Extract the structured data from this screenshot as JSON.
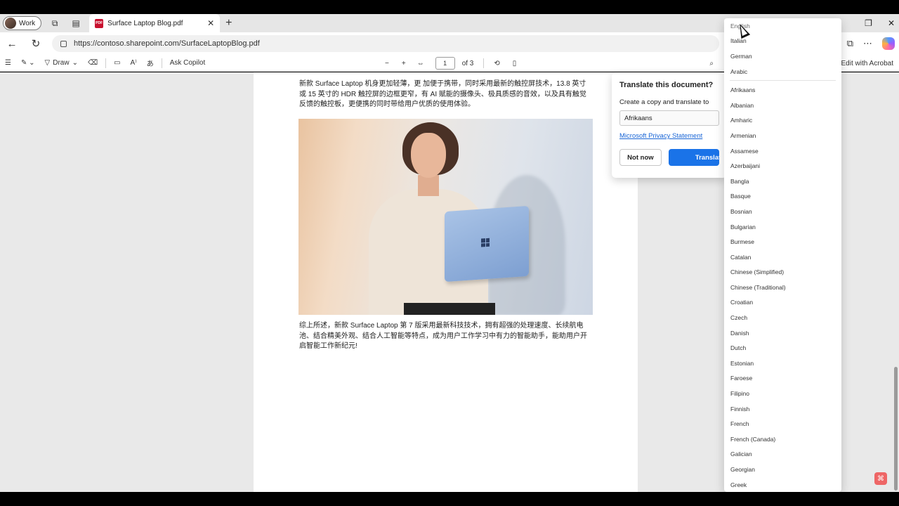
{
  "browser": {
    "profile_label": "Work",
    "tab_title": "Surface Laptop Blog.pdf",
    "tab_icon_label": "PDF",
    "url": "https://contoso.sharepoint.com/SurfaceLaptopBlog.pdf"
  },
  "pdf_toolbar": {
    "draw_label": "Draw",
    "ask_copilot_label": "Ask Copilot",
    "page_current": "1",
    "page_total": "of 3",
    "edit_acrobat_label": "Edit with Acrobat"
  },
  "document": {
    "paragraph_1": "新款 Surface Laptop 机身更加轻薄，更 加便于携带，同时采用最新的触控屏技术，13.8 英寸或 15 英寸的 HDR 触控屏的边框更窄，有 AI 赋能的摄像头、极具质感的音效，以及具有触觉反馈的触控板，更便携的同时带给用户优质的使用体验。",
    "paragraph_2": "综上所述，新款 Surface Laptop 第 7 版采用最新科技技术，拥有超强的处理速度、长续航电池、结合精美外观、结合人工智能等特点，成为用户工作学习中有力的智能助手，能助用户开启智能工作新纪元!"
  },
  "translate_popup": {
    "title": "Translate this document?",
    "label": "Create a copy and translate to",
    "selected_language": "Afrikaans",
    "privacy_link": "Microsoft Privacy Statement",
    "not_now": "Not now",
    "translate": "Translate"
  },
  "language_list": {
    "top": [
      "English",
      "Italian",
      "German",
      "Arabic"
    ],
    "all": [
      "Afrikaans",
      "Albanian",
      "Amharic",
      "Armenian",
      "Assamese",
      "Azerbaijani",
      "Bangla",
      "Basque",
      "Bosnian",
      "Bulgarian",
      "Burmese",
      "Catalan",
      "Chinese (Simplified)",
      "Chinese (Traditional)",
      "Croatian",
      "Czech",
      "Danish",
      "Dutch",
      "Estonian",
      "Faroese",
      "Filipino",
      "Finnish",
      "French",
      "French (Canada)",
      "Galician",
      "Georgian",
      "Greek"
    ]
  }
}
